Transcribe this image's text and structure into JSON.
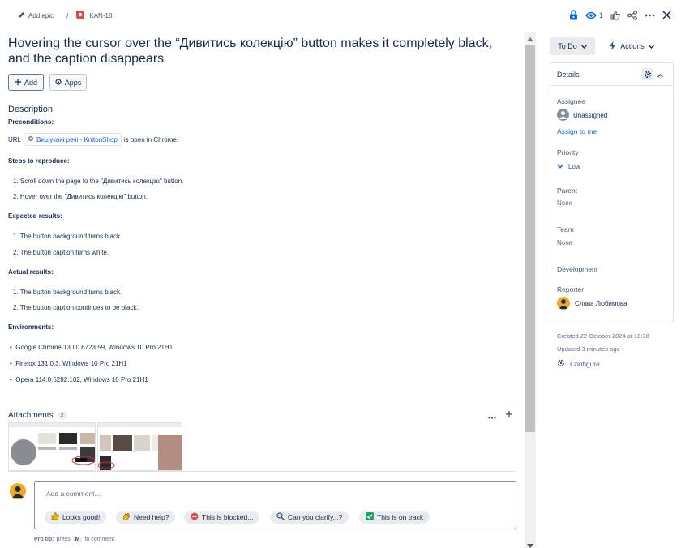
{
  "breadcrumb": {
    "add_epic": "Add epic",
    "separator": "/",
    "issue_key": "KAN-18"
  },
  "toolbar": {
    "watch_count": "1"
  },
  "issue": {
    "title": "Hovering the cursor over the “Дивитись колекцію” button makes it completely black, and the caption disappears"
  },
  "buttons": {
    "add": "Add",
    "apps": "Apps"
  },
  "description": {
    "heading": "Description",
    "preconditions_label": "Preconditions:",
    "url_prefix": "URL",
    "url_link": "Вишукані речі - KnitonShop",
    "url_suffix": "is open in Chrome.",
    "steps_label": "Steps to reproduce:",
    "steps": [
      "1. Scroll down the page to the \"Дивитись колекцію\" button.",
      "2. Hover over the \"Дивитись колекцію\" button."
    ],
    "expected_label": "Expected results:",
    "expected": [
      "1. The button background turns black.",
      "2. The button caption turns white."
    ],
    "actual_label": "Actual results:",
    "actual": [
      "1. The button background turns black.",
      "2. The button caption continues to be black."
    ],
    "env_label": "Environments:",
    "environments": [
      "Google Chrome 130.0.6723.59, Windows 10 Pro 21H1",
      "Firefox 131.0.3, Windows 10 Pro 21H1",
      "Opera 114.0.5282.102, Windows 10 Pro 21H1"
    ]
  },
  "attachments": {
    "label": "Attachments",
    "count": "2"
  },
  "comment": {
    "placeholder": "Add a comment...",
    "quick_replies": [
      "Looks good!",
      "Need help?",
      "This is blocked...",
      "Can you clarify...?",
      "This is on track"
    ],
    "pro_tip_label": "Pro tip:",
    "pro_tip_press": "press",
    "pro_tip_key": "M",
    "pro_tip_suffix": "to comment"
  },
  "sidebar": {
    "status": "To Do",
    "actions": "Actions",
    "details_title": "Details",
    "assignee_label": "Assignee",
    "assignee_value": "Unassigned",
    "assign_to_me": "Assign to me",
    "priority_label": "Priority",
    "priority_value": "Low",
    "parent_label": "Parent",
    "parent_value": "None",
    "team_label": "Team",
    "team_value": "None",
    "development_label": "Development",
    "reporter_label": "Reporter",
    "reporter_value": "Слава Любимова",
    "created": "Created 22 October 2024 at 18:38",
    "updated": "Updated 3 minutes ago",
    "configure": "Configure"
  },
  "colors": {
    "accent": "#0c66e4",
    "avatar": "#f5a623",
    "issue_type": "#e2483d"
  }
}
